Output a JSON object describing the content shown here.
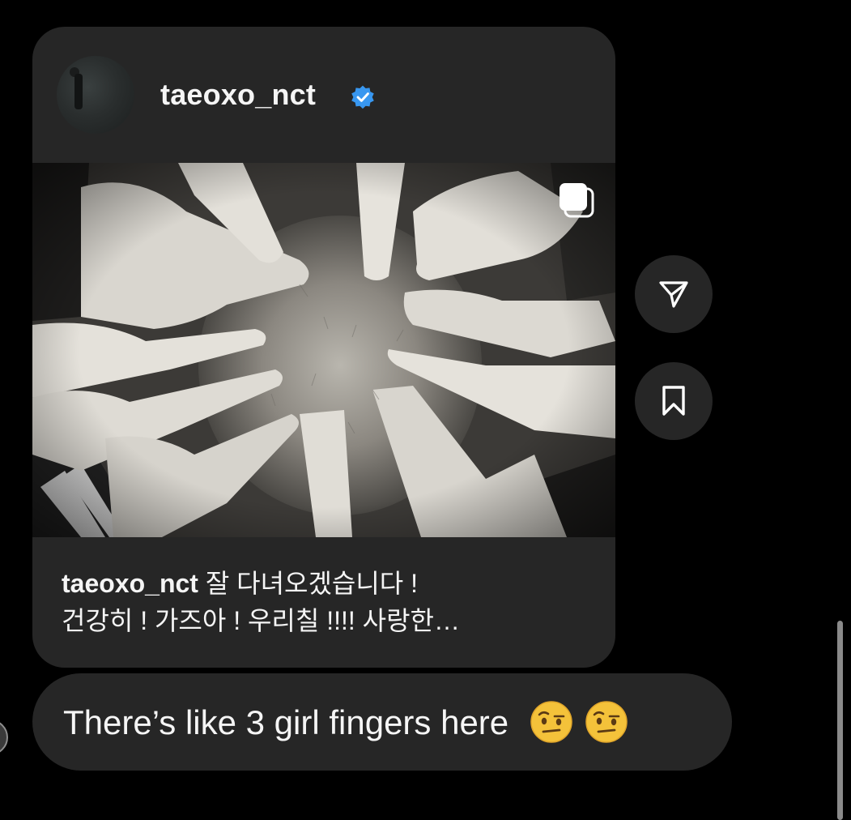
{
  "shared_post": {
    "username": "taeoxo_nct",
    "verified": true,
    "caption_user": "taeoxo_nct",
    "caption_line1": "잘 다녀오겠습니다 !",
    "caption_line2": "건강히 ! 가즈아 ! 우리칠 !!!! 사랑한…",
    "multi_photo": true
  },
  "actions": {
    "share_icon": "paper-plane-icon",
    "save_icon": "bookmark-icon"
  },
  "message": {
    "text": "There’s like 3 girl fingers here",
    "emojis": [
      "face-with-raised-eyebrow",
      "face-with-raised-eyebrow"
    ]
  },
  "colors": {
    "background": "#000000",
    "bubble": "#262626",
    "verified_blue": "#3897f0",
    "text": "#f5f5f5"
  }
}
